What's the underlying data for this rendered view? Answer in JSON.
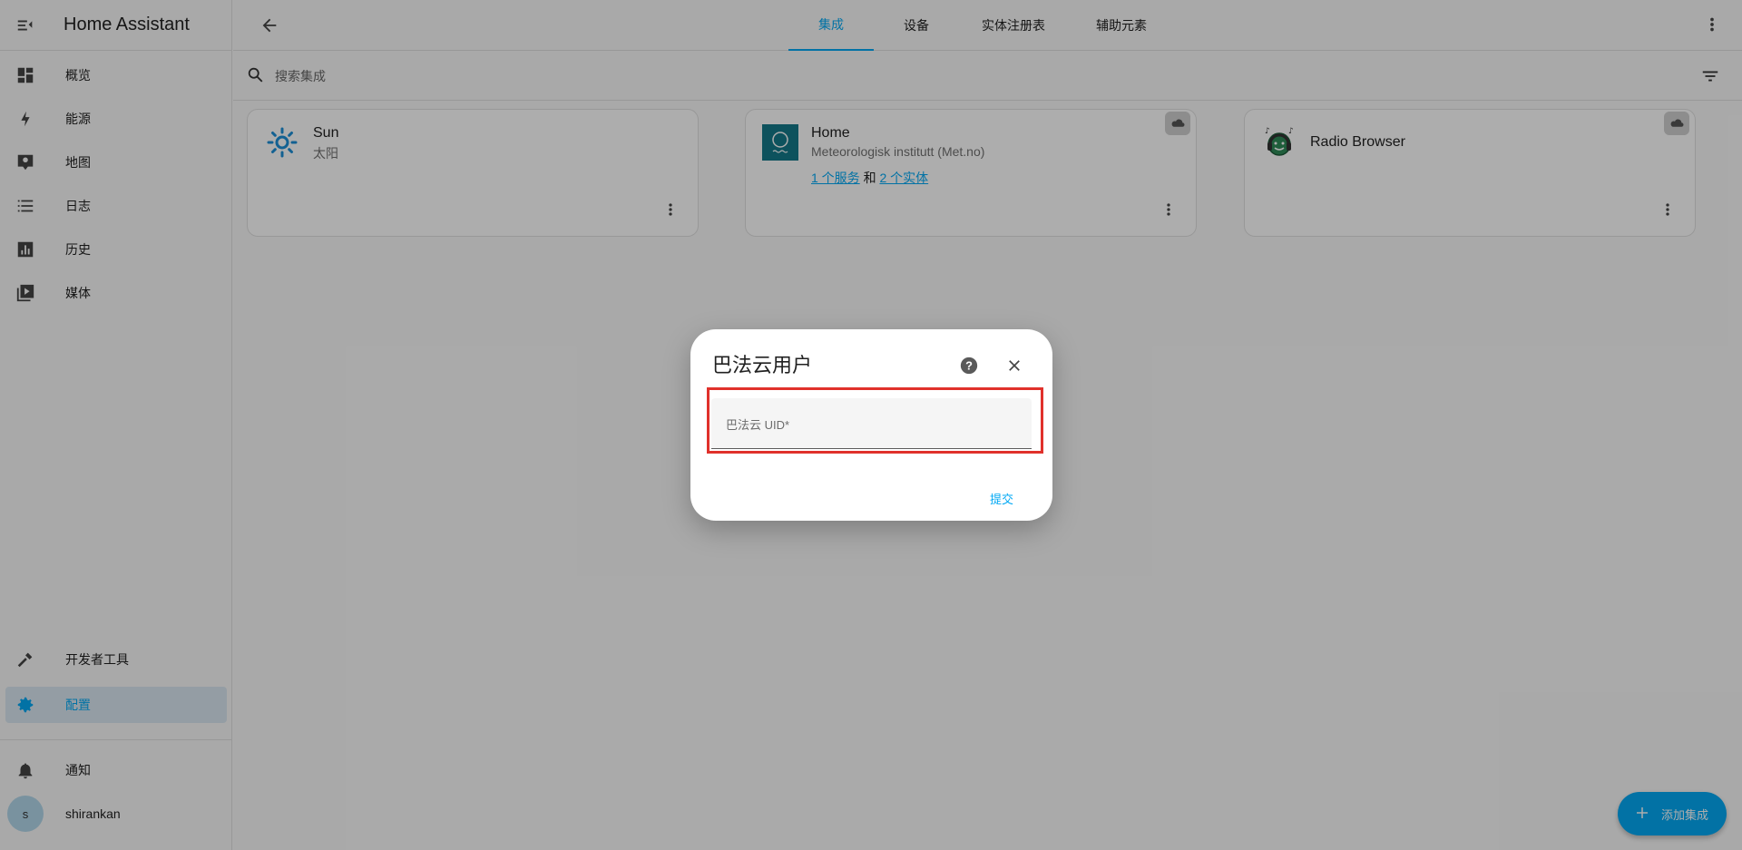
{
  "sidebar": {
    "title": "Home Assistant",
    "items": [
      {
        "label": "概览",
        "icon": "dashboard-icon"
      },
      {
        "label": "能源",
        "icon": "lightning-icon"
      },
      {
        "label": "地图",
        "icon": "map-icon"
      },
      {
        "label": "日志",
        "icon": "list-icon"
      },
      {
        "label": "历史",
        "icon": "chart-icon"
      },
      {
        "label": "媒体",
        "icon": "media-icon"
      }
    ],
    "developer_tools": "开发者工具",
    "config": "配置",
    "notifications": "通知",
    "user": {
      "initial": "s",
      "name": "shirankan"
    }
  },
  "topbar": {
    "tabs": [
      "集成",
      "设备",
      "实体注册表",
      "辅助元素"
    ],
    "active_tab": "集成"
  },
  "search": {
    "placeholder": "搜索集成"
  },
  "cards": [
    {
      "title": "Sun",
      "subtitle": "太阳"
    },
    {
      "title": "Home",
      "subtitle": "Meteorologisk institutt (Met.no)",
      "link_services": "1 个服务",
      "conjunction": "和",
      "link_entities": "2 个实体"
    },
    {
      "title": "Radio Browser"
    }
  ],
  "fab": {
    "label": "添加集成"
  },
  "dialog": {
    "title": "巴法云用户",
    "field_label": "巴法云 UID*",
    "field_value": "",
    "submit_label": "提交"
  },
  "colors": {
    "accent": "#03a9f4",
    "highlight": "#e0312b",
    "met_logo_bg": "#147a8a"
  }
}
